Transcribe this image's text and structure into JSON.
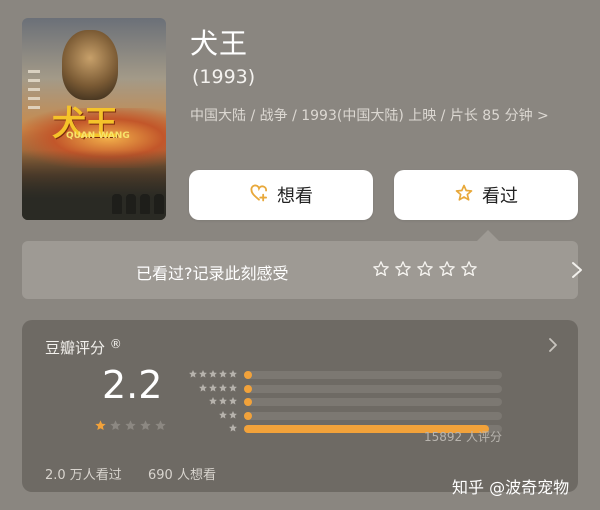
{
  "movie": {
    "title": "犬王",
    "year": "(1993)",
    "meta": "中国大陆 / 战争 / 1993(中国大陆) 上映 / 片长 85 分钟 >",
    "poster_text": "犬王",
    "poster_subtext": "QUAN WANG"
  },
  "actions": {
    "want_label": "想看",
    "seen_label": "看过"
  },
  "record": {
    "prompt": "已看过?记录此刻感受",
    "stars": 5
  },
  "rating": {
    "label": "豆瓣评分",
    "registered": "®",
    "score": "2.2",
    "score_stars_filled": 1,
    "distribution": [
      {
        "stars": 5,
        "fraction": 0.03
      },
      {
        "stars": 4,
        "fraction": 0.03
      },
      {
        "stars": 3,
        "fraction": 0.03
      },
      {
        "stars": 2,
        "fraction": 0.03
      },
      {
        "stars": 1,
        "fraction": 0.95
      }
    ],
    "count_text": "15892 人评分",
    "watched_text": "2.0 万人看过",
    "wanted_text": "690 人想看"
  },
  "watermark": "知乎 @波奇宠物",
  "colors": {
    "accent": "#f2a23a",
    "background": "#8a8680"
  }
}
